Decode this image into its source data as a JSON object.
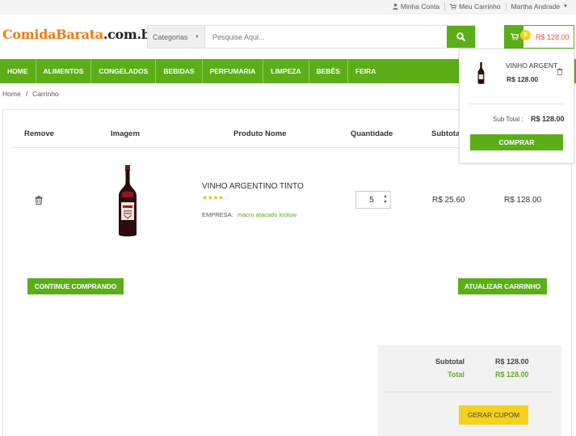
{
  "topbar": {
    "account": "Minha Conta",
    "cart": "Meu Carrinho",
    "user": "Martha Andrade"
  },
  "logo": {
    "part1": "ComidaBarata",
    "part2": ".com.br"
  },
  "search": {
    "category_label": "Categorias",
    "placeholder": "Pesquise Aqui..."
  },
  "cart_header": {
    "count": "5",
    "amount": "R$ 128.00"
  },
  "nav": {
    "items": [
      "HOME",
      "ALIMENTOS",
      "CONGELADOS",
      "BEBIDAS",
      "PERFUMARIA",
      "LIMPEZA",
      "BEBÊS",
      "FEIRA"
    ]
  },
  "breadcrumb": {
    "home": "Home",
    "sep": "/",
    "current": "Carrinho"
  },
  "table": {
    "headers": {
      "remove": "Remove",
      "image": "Imagem",
      "name": "Produto Nome",
      "qty": "Quantidade",
      "subtotal": "Subtotal"
    },
    "row": {
      "name": "VINHO ARGENTINO TINTO",
      "rating": 3.5,
      "empresa_label": "EMPRESA:",
      "empresa": "macro atacado krolow",
      "qty": "5",
      "unit_price": "R$ 25.60",
      "total": "R$ 128.00"
    }
  },
  "buttons": {
    "continue": "CONTINUE COMPRANDO",
    "update": "ATUALIZAR CARRINHO",
    "coupon": "GERAR CUPOM"
  },
  "totals": {
    "subtotal_label": "Subtotal",
    "subtotal_value": "R$ 128.00",
    "total_label": "Total",
    "total_value": "R$ 128.00"
  },
  "mini_cart": {
    "item_name": "VINHO ARGENT",
    "item_price": "R$ 128.00",
    "subtotal_label": "Sub Total :",
    "subtotal_value": "R$ 128.00",
    "buy": "COMPRAR"
  },
  "colors": {
    "brand_green": "#5cae18",
    "logo_orange": "#f07a12",
    "badge_yellow": "#f7d21c",
    "price_red": "#e84c3d"
  },
  "icons": [
    "user-icon",
    "cart-icon",
    "search-icon",
    "trash-icon",
    "wine-bottle-icon",
    "star-icon",
    "spinner-arrows-icon"
  ]
}
